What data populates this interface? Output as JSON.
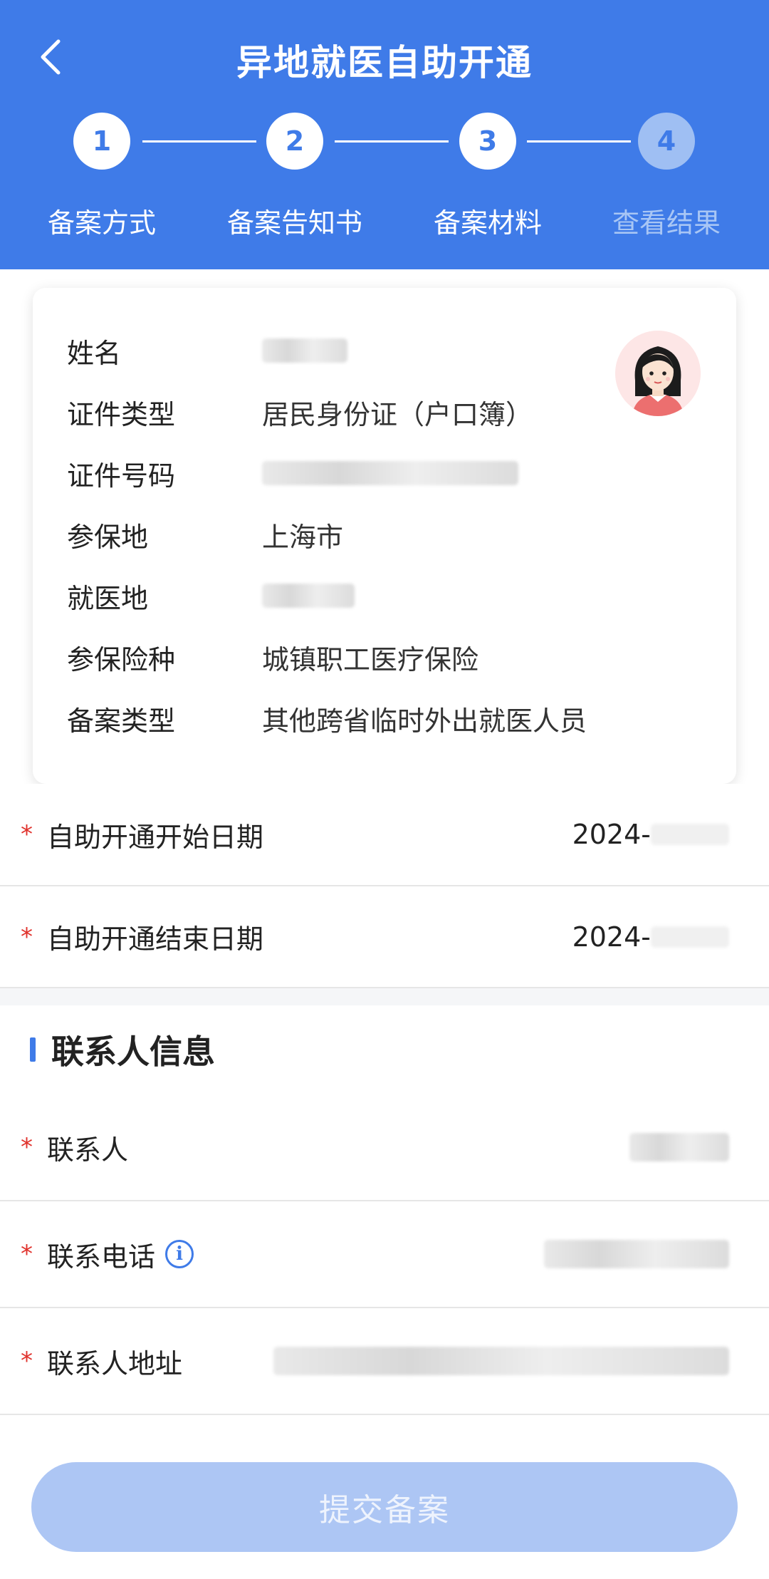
{
  "header": {
    "title": "异地就医自助开通",
    "colors": {
      "primary": "#3f7be8",
      "inactive_step": "#9fbff3"
    },
    "back_icon": "chevron-left-icon",
    "steps": [
      {
        "number": "1",
        "label": "备案方式",
        "active": true
      },
      {
        "number": "2",
        "label": "备案告知书",
        "active": true
      },
      {
        "number": "3",
        "label": "备案材料",
        "active": true
      },
      {
        "number": "4",
        "label": "查看结果",
        "active": false
      }
    ]
  },
  "card": {
    "avatar_icon": "female-avatar-icon",
    "rows": [
      {
        "label": "姓名",
        "value": ""
      },
      {
        "label": "证件类型",
        "value": "居民身份证（户口簿）"
      },
      {
        "label": "证件号码",
        "value": ""
      },
      {
        "label": "参保地",
        "value": "上海市"
      },
      {
        "label": "就医地",
        "value": ""
      },
      {
        "label": "参保险种",
        "value": "城镇职工医疗保险"
      },
      {
        "label": "备案类型",
        "value": "其他跨省临时外出就医人员"
      }
    ]
  },
  "dates": {
    "start_label": "自助开通开始日期",
    "start_value": "2024-",
    "end_label": "自助开通结束日期",
    "end_value": "2024-"
  },
  "contact": {
    "section_title": "联系人信息",
    "required_mark": "*",
    "name_label": "联系人",
    "phone_label": "联系电话",
    "phone_info_icon": "info-circle-icon",
    "address_label": "联系人地址"
  },
  "submit": {
    "label": "提交备案",
    "color": "#adc6f4"
  }
}
